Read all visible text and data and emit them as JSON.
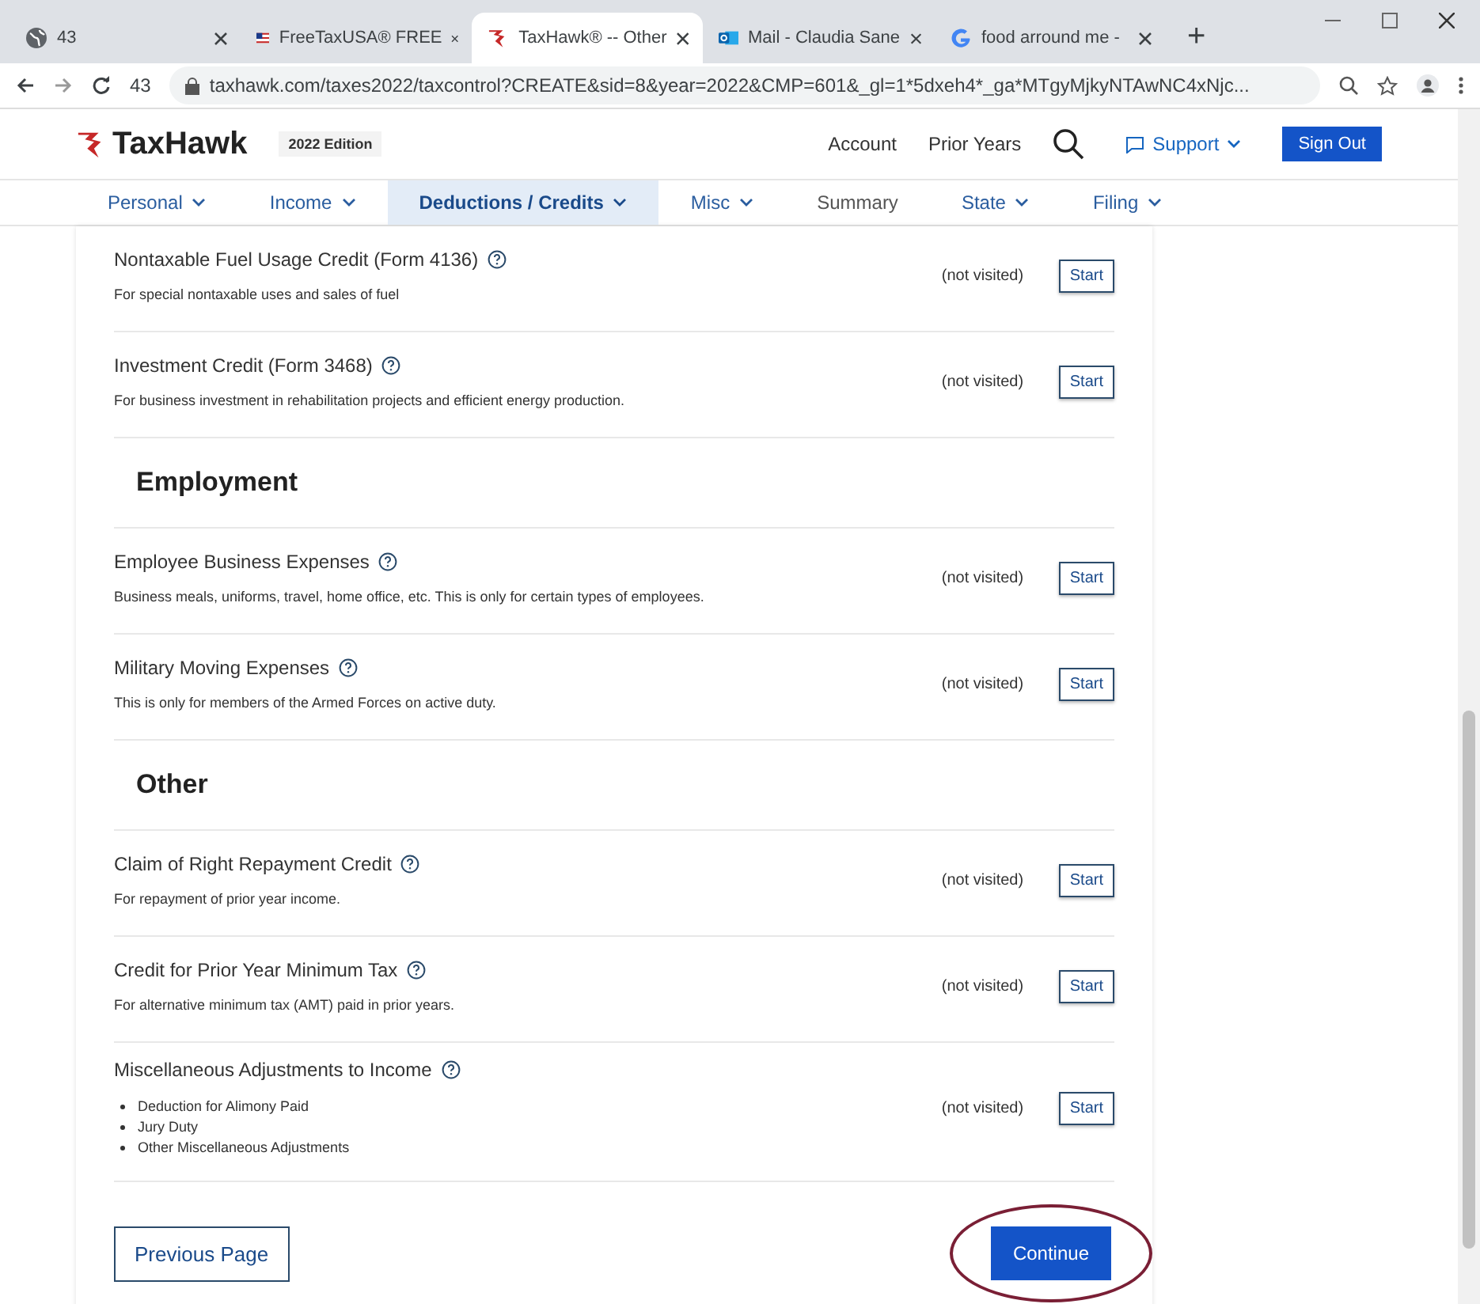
{
  "browser": {
    "tabs": [
      {
        "title": "43",
        "selected": false
      },
      {
        "title": "FreeTaxUSA® FREE",
        "selected": false
      },
      {
        "title": "TaxHawk® -- Other",
        "selected": true
      },
      {
        "title": "Mail - Claudia Sane",
        "selected": false
      },
      {
        "title": "food arround me -",
        "selected": false
      }
    ],
    "new_tab": "+",
    "reload_badge": "43",
    "url": "taxhawk.com/taxes2022/taxcontrol?CREATE&sid=8&year=2022&CMP=601&_gl=1*5dxeh4*_ga*MTgyMjkyNTAwNC4xNjc..."
  },
  "header": {
    "logo": "TaxHawk",
    "edition": "2022 Edition",
    "links": [
      "Account",
      "Prior Years"
    ],
    "support": "Support",
    "sign_out": "Sign Out"
  },
  "nav": [
    {
      "label": "Personal",
      "selected": false,
      "dropdown": true
    },
    {
      "label": "Income",
      "selected": false,
      "dropdown": true
    },
    {
      "label": "Deductions / Credits",
      "selected": true,
      "dropdown": true
    },
    {
      "label": "Misc",
      "selected": false,
      "dropdown": true
    },
    {
      "label": "Summary",
      "selected": false,
      "dropdown": false
    },
    {
      "label": "State",
      "selected": false,
      "dropdown": true
    },
    {
      "label": "Filing",
      "selected": false,
      "dropdown": true
    }
  ],
  "sections": [
    {
      "kind": "items",
      "items": [
        {
          "title": "Nontaxable Fuel Usage Credit (Form 4136)",
          "description": "For special nontaxable uses and sales of fuel",
          "status": "(not visited)",
          "action": "Start"
        },
        {
          "title": "Investment Credit (Form 3468)",
          "description": "For business investment in rehabilitation projects and efficient energy production.",
          "status": "(not visited)",
          "action": "Start"
        }
      ]
    },
    {
      "kind": "heading",
      "title": "Employment",
      "items": [
        {
          "title": "Employee Business Expenses",
          "description": "Business meals, uniforms, travel, home office, etc. This is only for certain types of employees.",
          "status": "(not visited)",
          "action": "Start"
        },
        {
          "title": "Military Moving Expenses",
          "description": "This is only for members of the Armed Forces on active duty.",
          "status": "(not visited)",
          "action": "Start"
        }
      ]
    },
    {
      "kind": "heading",
      "title": "Other",
      "items": [
        {
          "title": "Claim of Right Repayment Credit",
          "description": "For repayment of prior year income.",
          "status": "(not visited)",
          "action": "Start"
        },
        {
          "title": "Credit for Prior Year Minimum Tax",
          "description": "For alternative minimum tax (AMT) paid in prior years.",
          "status": "(not visited)",
          "action": "Start"
        },
        {
          "title": "Miscellaneous Adjustments to Income",
          "bullets": [
            "Deduction for Alimony Paid",
            "Jury Duty",
            "Other Miscellaneous Adjustments"
          ],
          "status": "(not visited)",
          "action": "Start"
        }
      ]
    }
  ],
  "footer": {
    "previous": "Previous Page",
    "continue": "Continue"
  }
}
